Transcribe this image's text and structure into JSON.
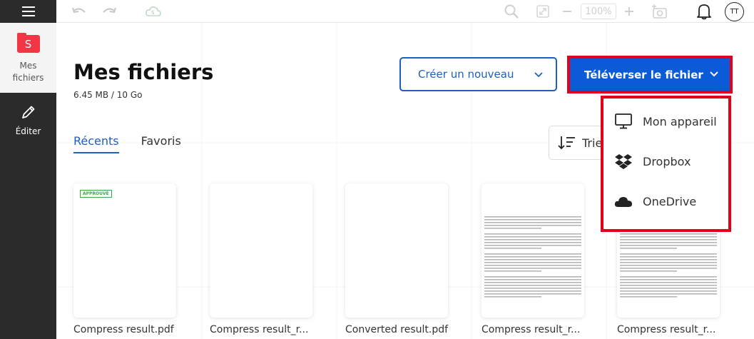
{
  "sidebar": {
    "files_logo_letter": "S",
    "files_label": "Mes fichiers",
    "edit_label": "Éditer"
  },
  "toolbar": {
    "zoom": "100%",
    "avatar_initials": "TT"
  },
  "main": {
    "title": "Mes fichiers",
    "storage": "6.45 MB / 10 Go",
    "create_label": "Créer un nouveau",
    "upload_label": "Téléverser le fichier",
    "sort_label": "Trie",
    "tabs": [
      {
        "label": "Récents",
        "active": true
      },
      {
        "label": "Favoris",
        "active": false
      }
    ]
  },
  "files": [
    {
      "name": "Compress result.pdf",
      "stamp": "APPROUVÉ"
    },
    {
      "name": "Compress result_r..."
    },
    {
      "name": "Converted result.pdf"
    },
    {
      "name": "Compress result_r..."
    },
    {
      "name": "Compress result_r..."
    }
  ],
  "upload_menu": [
    {
      "label": "Mon appareil",
      "icon": "monitor-icon"
    },
    {
      "label": "Dropbox",
      "icon": "dropbox-icon"
    },
    {
      "label": "OneDrive",
      "icon": "onedrive-icon"
    }
  ],
  "colors": {
    "accent": "#1f5fbf",
    "upload_bg": "#0b5ad8",
    "highlight": "#e3001a",
    "logo": "#f23645",
    "sidebar": "#2b2b2b"
  }
}
